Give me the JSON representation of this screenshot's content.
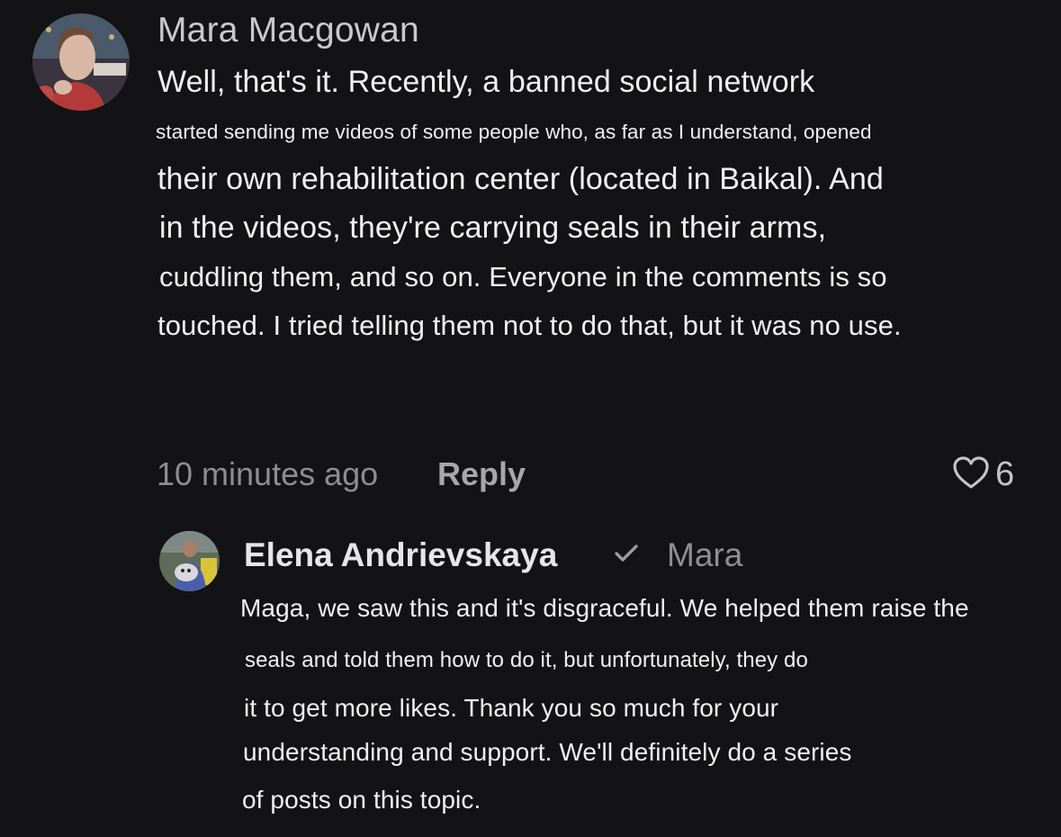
{
  "comment": {
    "author": "Mara Macgowan",
    "lines": [
      "Well, that's it. Recently, a banned social network",
      "started sending me videos of some people who, as far as I understand, opened",
      "their own rehabilitation center (located in Baikal). And",
      "in the videos, they're carrying seals in their arms,",
      "cuddling them, and so on. Everyone in the comments is so",
      "touched. I tried telling them not to do that, but it was no use."
    ],
    "timestamp": "10 minutes ago",
    "reply_label": "Reply",
    "likes": "6",
    "like_icon": "heart-outline-icon"
  },
  "reply": {
    "author": "Elena Andrievskaya",
    "verified_icon": "checkmark-icon",
    "mention": "Mara",
    "lines": [
      "Maga, we saw this and it's disgraceful. We helped them raise the",
      "seals and told them how to do it, but unfortunately, they do",
      "it to get more likes. Thank you so much for your",
      "understanding and support. We'll definitely do a series",
      "of posts on this topic."
    ]
  },
  "colors": {
    "background": "#131315",
    "text": "#f0f0f2",
    "muted": "#8d8d92"
  }
}
